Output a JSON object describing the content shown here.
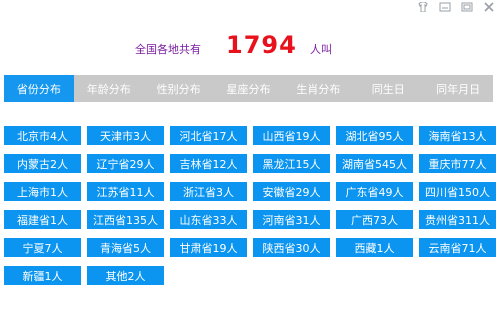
{
  "window": {
    "controls": [
      {
        "icon": "skin-icon"
      },
      {
        "icon": "minimize-icon"
      },
      {
        "icon": "restore-icon"
      },
      {
        "icon": "close-icon"
      }
    ]
  },
  "header": {
    "prefix": "全国各地共有",
    "count": "1794",
    "suffix": "人叫",
    "colors": {
      "label": "#7a1ea0",
      "count": "#e8121c"
    }
  },
  "tabs": [
    {
      "label": "省份分布",
      "active": true
    },
    {
      "label": "年龄分布",
      "active": false
    },
    {
      "label": "性别分布",
      "active": false
    },
    {
      "label": "星座分布",
      "active": false
    },
    {
      "label": "生肖分布",
      "active": false
    },
    {
      "label": "同生日",
      "active": false
    },
    {
      "label": "同年月日",
      "active": false
    }
  ],
  "provinces": [
    "北京市4人",
    "天津市3人",
    "河北省17人",
    "山西省19人",
    "湖北省95人",
    "海南省13人",
    "内蒙古2人",
    "辽宁省29人",
    "吉林省12人",
    "黑龙江15人",
    "湖南省545人",
    "重庆市77人",
    "上海市1人",
    "江苏省11人",
    "浙江省3人",
    "安徽省29人",
    "广东省49人",
    "四川省150人",
    "福建省1人",
    "江西省135人",
    "山东省33人",
    "河南省31人",
    "广西73人",
    "贵州省311人",
    "宁夏7人",
    "青海省5人",
    "甘肃省19人",
    "陕西省30人",
    "西藏1人",
    "云南省71人",
    "新疆1人",
    "其他2人"
  ],
  "colors": {
    "tab_active": "#1597f0",
    "tab_bar": "#c9c9c9",
    "cell": "#0b95f0"
  }
}
